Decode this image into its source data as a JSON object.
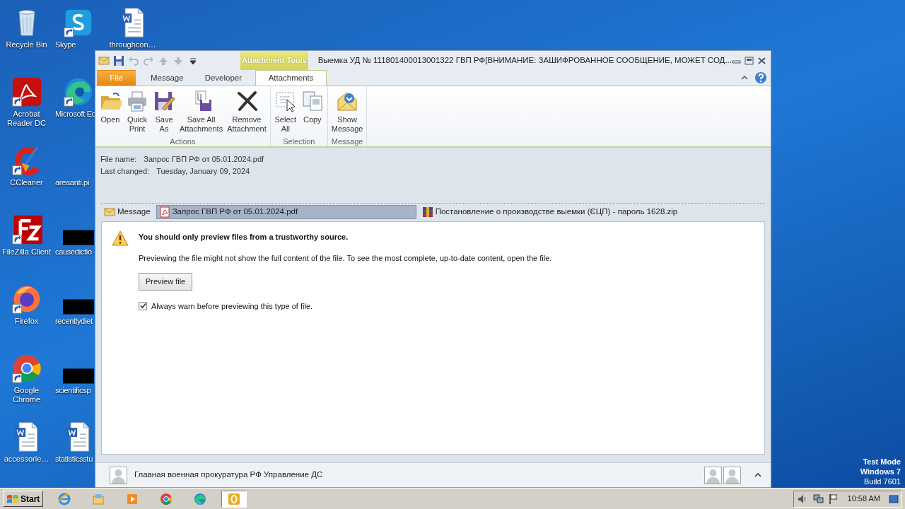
{
  "desktop": {
    "columns": [
      [
        {
          "label": "Recycle Bin",
          "kind": "recycle-bin",
          "shortcut": false
        },
        {
          "label": "Acrobat\nReader DC",
          "kind": "acrobat",
          "shortcut": true
        },
        {
          "label": "CCleaner",
          "kind": "ccleaner",
          "shortcut": true
        },
        {
          "label": "FileZilla Client",
          "kind": "filezilla",
          "shortcut": true
        },
        {
          "label": "Firefox",
          "kind": "firefox",
          "shortcut": true
        },
        {
          "label": "Google\nChrome",
          "kind": "chrome",
          "shortcut": true
        },
        {
          "label": "accessorie…",
          "kind": "word-document",
          "shortcut": false
        }
      ],
      [
        {
          "label": "Skype",
          "kind": "skype",
          "shortcut": true
        },
        {
          "label": "Microsoft Ed",
          "kind": "edge",
          "shortcut": true
        },
        {
          "label": "areaanti.pi",
          "kind": "blank"
        },
        {
          "label": "causedictio",
          "kind": "redacted"
        },
        {
          "label": "recentlydiet",
          "kind": "redacted"
        },
        {
          "label": "scientificsp",
          "kind": "redacted"
        },
        {
          "label": "statisticsstu",
          "kind": "word-document",
          "shortcut": false
        }
      ],
      [
        {
          "label": "throughcon…",
          "kind": "word-document",
          "shortcut": false
        }
      ]
    ]
  },
  "os_notice": [
    "Test Mode",
    "Windows 7",
    "Build 7601"
  ],
  "window": {
    "quick_access": [
      {
        "kind": "mail",
        "disabled": false
      },
      {
        "kind": "save",
        "disabled": false
      },
      {
        "kind": "undo",
        "disabled": true
      },
      {
        "kind": "redo",
        "disabled": true
      },
      {
        "kind": "up",
        "disabled": true
      },
      {
        "kind": "down",
        "disabled": true
      },
      {
        "kind": "customize",
        "disabled": false
      }
    ],
    "contextual_group": "Attachment Tools",
    "title": "Выемка УД № 111801400013001322  ГВП РФ[ВНИМАНИЕ: ЗАШИФРОВАННОЕ СООБЩЕНИЕ, МОЖЕТ СОД...",
    "tabs": [
      {
        "label": "File",
        "kind": "backstage",
        "selected": false
      },
      {
        "label": "Message",
        "kind": "standard",
        "selected": false
      },
      {
        "label": "Developer",
        "kind": "standard",
        "selected": false
      },
      {
        "label": "Attachments",
        "kind": "contextual",
        "selected": true
      }
    ],
    "ribbon_groups": [
      {
        "label": "Actions",
        "buttons": [
          {
            "label": "Open",
            "kind": "folder"
          },
          {
            "label": "Quick\nPrint",
            "kind": "printer"
          },
          {
            "label": "Save\nAs",
            "kind": "save-as"
          },
          {
            "label": "Save All\nAttachments",
            "kind": "save-all"
          },
          {
            "label": "Remove\nAttachment",
            "kind": "remove"
          }
        ]
      },
      {
        "label": "Selection",
        "buttons": [
          {
            "label": "Select\nAll",
            "kind": "select-all"
          },
          {
            "label": "Copy",
            "kind": "copy"
          }
        ]
      },
      {
        "label": "Message",
        "buttons": [
          {
            "label": "Show\nMessage",
            "kind": "show-message"
          }
        ]
      }
    ],
    "file_info": [
      {
        "label": "File name:",
        "value": "Запрос ГВП РФ от 05.01.2024.pdf"
      },
      {
        "label": "Last changed:",
        "value": "Tuesday, January 09, 2024"
      }
    ],
    "attachments": [
      {
        "label": "Message",
        "kind": "envelope",
        "selected": false
      },
      {
        "label": "Запрос ГВП РФ от 05.01.2024.pdf",
        "kind": "pdf",
        "selected": true
      },
      {
        "label": "Постановление о производстве выемки (ЄЦП) - пароль 1628.zip",
        "kind": "archive",
        "selected": false
      }
    ],
    "preview": {
      "heading": "You should only preview files from a trustworthy source.",
      "body": "Previewing the file might not show the full content of the file. To see the most complete, up-to-date content, open the file.",
      "button": "Preview file",
      "checkbox": {
        "label": "Always warn before previewing this type of file.",
        "checked": true
      }
    },
    "people_pane": {
      "sender": "Главная военная прокуратура РФ Управление ДС"
    }
  },
  "taskbar": {
    "start": "Start",
    "apps": [
      {
        "kind": "ie",
        "active": false
      },
      {
        "kind": "explorer",
        "active": false
      },
      {
        "kind": "media",
        "active": false
      },
      {
        "kind": "chrome",
        "active": false
      },
      {
        "kind": "edge",
        "active": false
      },
      {
        "kind": "outlook",
        "active": true
      }
    ],
    "clock": "10:58 AM"
  }
}
